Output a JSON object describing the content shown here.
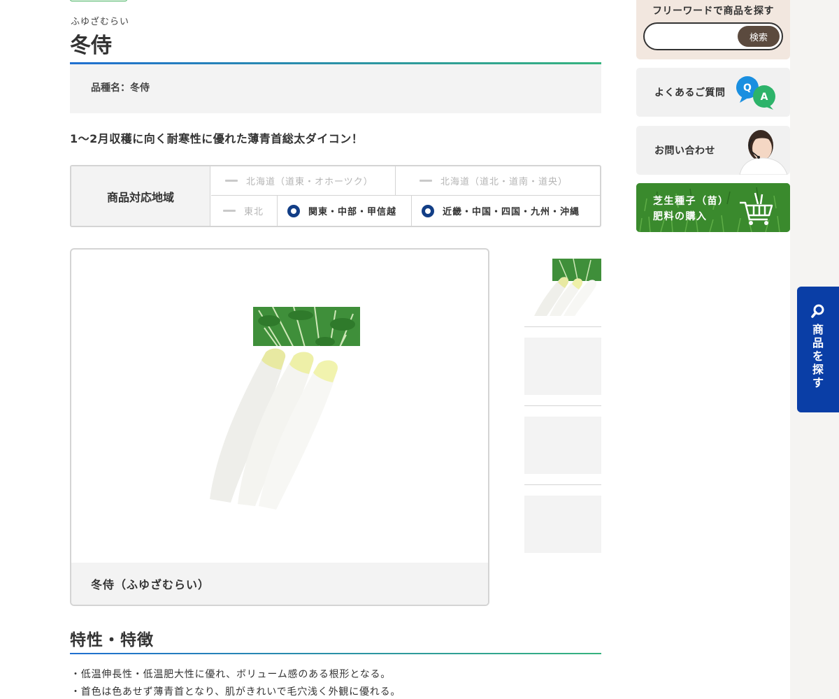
{
  "product": {
    "ruby": "ふゆざむらい",
    "title": "冬侍",
    "variety_label": "品種名：冬侍",
    "catchcopy": "1〜2月収穫に向く耐寒性に優れた薄青首総太ダイコン！"
  },
  "regions": {
    "header": "商品対応地域",
    "items": [
      {
        "label": "北海道（道東・オホーツク）",
        "available": false
      },
      {
        "label": "北海道（道北・道南・道央）",
        "available": false
      },
      {
        "label": "東北",
        "available": false
      },
      {
        "label": "関東・中部・甲信越",
        "available": true
      },
      {
        "label": "近畿・中国・四国・九州・沖縄",
        "available": true
      }
    ]
  },
  "gallery": {
    "caption": "冬侍（ふゆざむらい）",
    "thumbnail_count": 4
  },
  "features": {
    "title": "特性・特徴",
    "items": [
      "・低温伸長性・低温肥大性に優れ、ボリューム感のある根形となる。",
      "・首色は色あせず薄青首となり、肌がきれいで毛穴浅く外観に優れる。"
    ]
  },
  "sidebar": {
    "search_title": "フリーワードで商品を探す",
    "search_placeholder": "",
    "search_button": "検索",
    "faq_label": "よくあるご質問",
    "faq_badge_q": "Q",
    "faq_badge_a": "A",
    "contact_label": "お問い合わせ",
    "turf_line1": "芝生種子（苗）",
    "turf_line2": "肥料の購入",
    "float_tab_label": "商品を探す"
  },
  "colors": {
    "accent_blue": "#0a3ea6",
    "radio_navy": "#123e86",
    "gradient_start": "#1f6fd0",
    "gradient_end": "#36b37e",
    "search_button": "#5b4a3e",
    "search_panel_bg": "#f2e7df",
    "qa_q": "#1a8fe0",
    "qa_a": "#2db36a"
  }
}
